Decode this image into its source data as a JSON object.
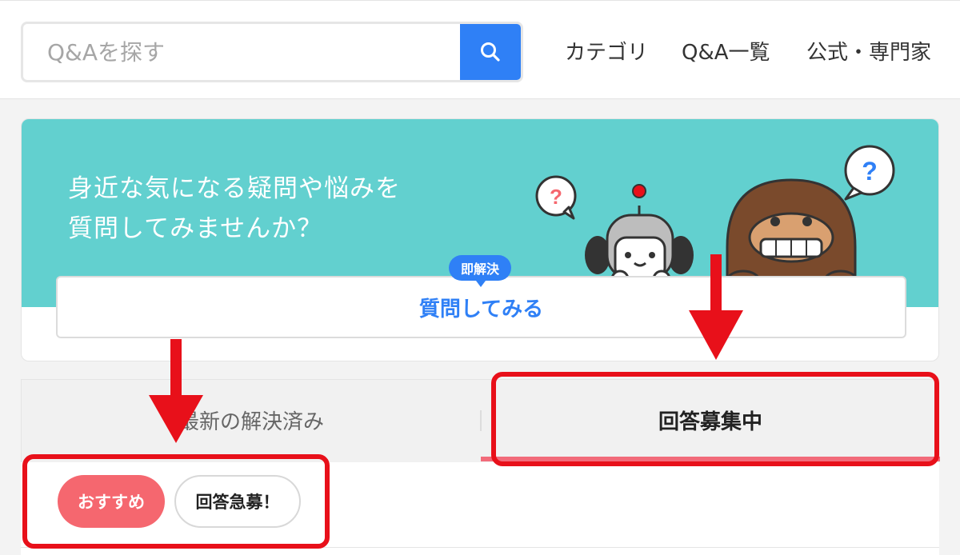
{
  "header": {
    "search_placeholder": "Q&Aを探す",
    "nav": [
      "カテゴリ",
      "Q&A一覧",
      "公式・専門家"
    ]
  },
  "banner": {
    "line1": "身近な気になる疑問や悩みを",
    "line2": "質問してみませんか？",
    "badge": "即解決",
    "button_label": "質問してみる",
    "bubble_mark": "?"
  },
  "tabs": {
    "left": "最新の解決済み",
    "right": "回答募集中",
    "active": "right"
  },
  "filters": [
    "おすすめ",
    "回答急募！"
  ],
  "colors": {
    "accent_blue": "#2f80f6",
    "banner_teal": "#62d0cf",
    "pink": "#f5676f",
    "annotation_red": "#e8101a"
  }
}
